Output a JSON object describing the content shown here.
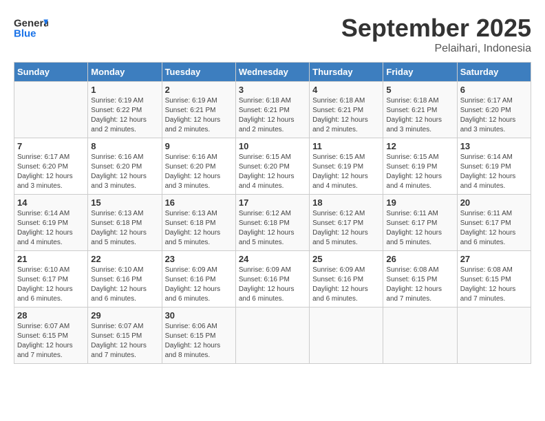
{
  "header": {
    "logo_general": "General",
    "logo_blue": "Blue",
    "month": "September 2025",
    "location": "Pelaihari, Indonesia"
  },
  "days_of_week": [
    "Sunday",
    "Monday",
    "Tuesday",
    "Wednesday",
    "Thursday",
    "Friday",
    "Saturday"
  ],
  "weeks": [
    [
      {
        "day": "",
        "sunrise": "",
        "sunset": "",
        "daylight": ""
      },
      {
        "day": "1",
        "sunrise": "Sunrise: 6:19 AM",
        "sunset": "Sunset: 6:22 PM",
        "daylight": "Daylight: 12 hours and 2 minutes."
      },
      {
        "day": "2",
        "sunrise": "Sunrise: 6:19 AM",
        "sunset": "Sunset: 6:21 PM",
        "daylight": "Daylight: 12 hours and 2 minutes."
      },
      {
        "day": "3",
        "sunrise": "Sunrise: 6:18 AM",
        "sunset": "Sunset: 6:21 PM",
        "daylight": "Daylight: 12 hours and 2 minutes."
      },
      {
        "day": "4",
        "sunrise": "Sunrise: 6:18 AM",
        "sunset": "Sunset: 6:21 PM",
        "daylight": "Daylight: 12 hours and 2 minutes."
      },
      {
        "day": "5",
        "sunrise": "Sunrise: 6:18 AM",
        "sunset": "Sunset: 6:21 PM",
        "daylight": "Daylight: 12 hours and 3 minutes."
      },
      {
        "day": "6",
        "sunrise": "Sunrise: 6:17 AM",
        "sunset": "Sunset: 6:20 PM",
        "daylight": "Daylight: 12 hours and 3 minutes."
      }
    ],
    [
      {
        "day": "7",
        "sunrise": "Sunrise: 6:17 AM",
        "sunset": "Sunset: 6:20 PM",
        "daylight": "Daylight: 12 hours and 3 minutes."
      },
      {
        "day": "8",
        "sunrise": "Sunrise: 6:16 AM",
        "sunset": "Sunset: 6:20 PM",
        "daylight": "Daylight: 12 hours and 3 minutes."
      },
      {
        "day": "9",
        "sunrise": "Sunrise: 6:16 AM",
        "sunset": "Sunset: 6:20 PM",
        "daylight": "Daylight: 12 hours and 3 minutes."
      },
      {
        "day": "10",
        "sunrise": "Sunrise: 6:15 AM",
        "sunset": "Sunset: 6:20 PM",
        "daylight": "Daylight: 12 hours and 4 minutes."
      },
      {
        "day": "11",
        "sunrise": "Sunrise: 6:15 AM",
        "sunset": "Sunset: 6:19 PM",
        "daylight": "Daylight: 12 hours and 4 minutes."
      },
      {
        "day": "12",
        "sunrise": "Sunrise: 6:15 AM",
        "sunset": "Sunset: 6:19 PM",
        "daylight": "Daylight: 12 hours and 4 minutes."
      },
      {
        "day": "13",
        "sunrise": "Sunrise: 6:14 AM",
        "sunset": "Sunset: 6:19 PM",
        "daylight": "Daylight: 12 hours and 4 minutes."
      }
    ],
    [
      {
        "day": "14",
        "sunrise": "Sunrise: 6:14 AM",
        "sunset": "Sunset: 6:19 PM",
        "daylight": "Daylight: 12 hours and 4 minutes."
      },
      {
        "day": "15",
        "sunrise": "Sunrise: 6:13 AM",
        "sunset": "Sunset: 6:18 PM",
        "daylight": "Daylight: 12 hours and 5 minutes."
      },
      {
        "day": "16",
        "sunrise": "Sunrise: 6:13 AM",
        "sunset": "Sunset: 6:18 PM",
        "daylight": "Daylight: 12 hours and 5 minutes."
      },
      {
        "day": "17",
        "sunrise": "Sunrise: 6:12 AM",
        "sunset": "Sunset: 6:18 PM",
        "daylight": "Daylight: 12 hours and 5 minutes."
      },
      {
        "day": "18",
        "sunrise": "Sunrise: 6:12 AM",
        "sunset": "Sunset: 6:17 PM",
        "daylight": "Daylight: 12 hours and 5 minutes."
      },
      {
        "day": "19",
        "sunrise": "Sunrise: 6:11 AM",
        "sunset": "Sunset: 6:17 PM",
        "daylight": "Daylight: 12 hours and 5 minutes."
      },
      {
        "day": "20",
        "sunrise": "Sunrise: 6:11 AM",
        "sunset": "Sunset: 6:17 PM",
        "daylight": "Daylight: 12 hours and 6 minutes."
      }
    ],
    [
      {
        "day": "21",
        "sunrise": "Sunrise: 6:10 AM",
        "sunset": "Sunset: 6:17 PM",
        "daylight": "Daylight: 12 hours and 6 minutes."
      },
      {
        "day": "22",
        "sunrise": "Sunrise: 6:10 AM",
        "sunset": "Sunset: 6:16 PM",
        "daylight": "Daylight: 12 hours and 6 minutes."
      },
      {
        "day": "23",
        "sunrise": "Sunrise: 6:09 AM",
        "sunset": "Sunset: 6:16 PM",
        "daylight": "Daylight: 12 hours and 6 minutes."
      },
      {
        "day": "24",
        "sunrise": "Sunrise: 6:09 AM",
        "sunset": "Sunset: 6:16 PM",
        "daylight": "Daylight: 12 hours and 6 minutes."
      },
      {
        "day": "25",
        "sunrise": "Sunrise: 6:09 AM",
        "sunset": "Sunset: 6:16 PM",
        "daylight": "Daylight: 12 hours and 6 minutes."
      },
      {
        "day": "26",
        "sunrise": "Sunrise: 6:08 AM",
        "sunset": "Sunset: 6:15 PM",
        "daylight": "Daylight: 12 hours and 7 minutes."
      },
      {
        "day": "27",
        "sunrise": "Sunrise: 6:08 AM",
        "sunset": "Sunset: 6:15 PM",
        "daylight": "Daylight: 12 hours and 7 minutes."
      }
    ],
    [
      {
        "day": "28",
        "sunrise": "Sunrise: 6:07 AM",
        "sunset": "Sunset: 6:15 PM",
        "daylight": "Daylight: 12 hours and 7 minutes."
      },
      {
        "day": "29",
        "sunrise": "Sunrise: 6:07 AM",
        "sunset": "Sunset: 6:15 PM",
        "daylight": "Daylight: 12 hours and 7 minutes."
      },
      {
        "day": "30",
        "sunrise": "Sunrise: 6:06 AM",
        "sunset": "Sunset: 6:15 PM",
        "daylight": "Daylight: 12 hours and 8 minutes."
      },
      {
        "day": "",
        "sunrise": "",
        "sunset": "",
        "daylight": ""
      },
      {
        "day": "",
        "sunrise": "",
        "sunset": "",
        "daylight": ""
      },
      {
        "day": "",
        "sunrise": "",
        "sunset": "",
        "daylight": ""
      },
      {
        "day": "",
        "sunrise": "",
        "sunset": "",
        "daylight": ""
      }
    ]
  ]
}
